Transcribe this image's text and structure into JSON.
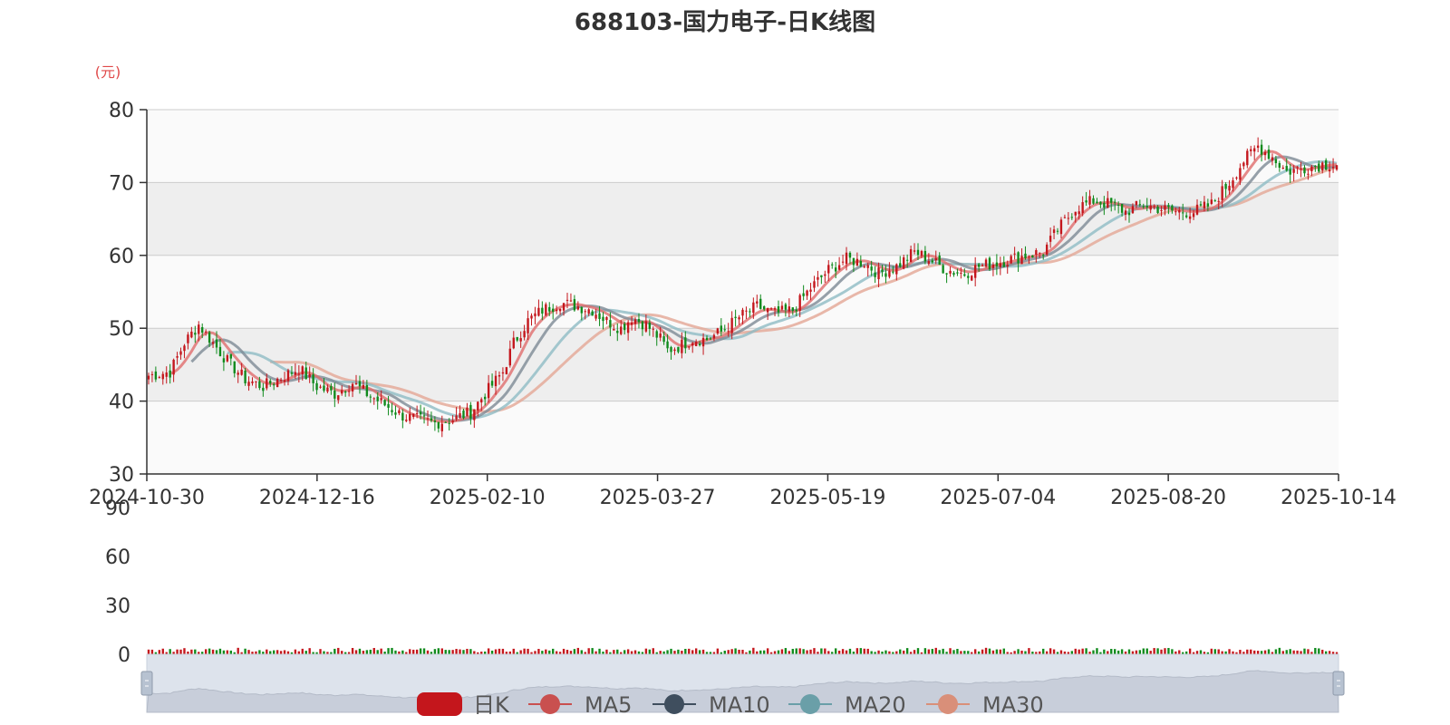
{
  "chart_data": {
    "type": "candlestick",
    "title": "688103-国力电子-日K线图",
    "y_unit": "(元)",
    "ylim": [
      30,
      80
    ],
    "y_ticks": [
      30,
      40,
      50,
      60,
      70,
      80
    ],
    "x_ticks": [
      "2024-10-30",
      "2024-12-16",
      "2025-02-10",
      "2025-03-27",
      "2025-05-19",
      "2025-07-04",
      "2025-08-20",
      "2025-10-14"
    ],
    "volume_ticks": [
      0,
      30,
      60,
      90
    ],
    "volume_ylim": [
      0,
      90
    ],
    "legend": [
      "日K",
      "MA5",
      "MA10",
      "MA20",
      "MA30"
    ],
    "series_colors": {
      "up": "#c4161c",
      "down": "#0f8a1c",
      "MA5": "#e06d6d",
      "MA10": "#7d8a95",
      "MA20": "#8fbcc4",
      "MA30": "#e3a695"
    },
    "price_path_points": [
      [
        0,
        43.5
      ],
      [
        6,
        44.0
      ],
      [
        10,
        48.0
      ],
      [
        14,
        50.5
      ],
      [
        18,
        48.0
      ],
      [
        22,
        45.5
      ],
      [
        27,
        43.0
      ],
      [
        32,
        42.0
      ],
      [
        38,
        43.5
      ],
      [
        42,
        44.5
      ],
      [
        47,
        42.0
      ],
      [
        52,
        41.0
      ],
      [
        57,
        42.5
      ],
      [
        61,
        41.0
      ],
      [
        66,
        39.5
      ],
      [
        71,
        38.0
      ],
      [
        75,
        37.5
      ],
      [
        80,
        37.0
      ],
      [
        85,
        37.5
      ],
      [
        90,
        38.5
      ],
      [
        94,
        41.0
      ],
      [
        99,
        44.0
      ],
      [
        102,
        48.0
      ],
      [
        106,
        51.0
      ],
      [
        110,
        52.5
      ],
      [
        115,
        53.5
      ],
      [
        120,
        53.0
      ],
      [
        124,
        52.5
      ],
      [
        128,
        51.0
      ],
      [
        132,
        50.0
      ],
      [
        135,
        51.5
      ],
      [
        139,
        50.5
      ],
      [
        143,
        48.5
      ],
      [
        145,
        47.0
      ],
      [
        148,
        47.5
      ],
      [
        152,
        48.5
      ],
      [
        156,
        48.5
      ],
      [
        160,
        49.5
      ],
      [
        165,
        51.5
      ],
      [
        170,
        53.0
      ],
      [
        175,
        52.0
      ],
      [
        180,
        52.5
      ],
      [
        185,
        55.5
      ],
      [
        190,
        58.0
      ],
      [
        195,
        59.5
      ],
      [
        200,
        59.0
      ],
      [
        204,
        57.5
      ],
      [
        209,
        58.5
      ],
      [
        214,
        60.5
      ],
      [
        218,
        59.5
      ],
      [
        223,
        58.0
      ],
      [
        228,
        57.5
      ],
      [
        232,
        58.5
      ],
      [
        237,
        59.0
      ],
      [
        241,
        59.5
      ],
      [
        245,
        60.0
      ],
      [
        250,
        60.5
      ],
      [
        254,
        63.5
      ],
      [
        259,
        66.5
      ],
      [
        264,
        67.5
      ],
      [
        269,
        67.0
      ],
      [
        273,
        66.0
      ],
      [
        278,
        67.0
      ],
      [
        282,
        66.5
      ],
      [
        287,
        66.0
      ],
      [
        292,
        66.0
      ],
      [
        297,
        67.0
      ],
      [
        302,
        70.0
      ],
      [
        306,
        73.0
      ],
      [
        310,
        75.0
      ],
      [
        314,
        73.5
      ],
      [
        318,
        71.5
      ],
      [
        323,
        72.0
      ],
      [
        328,
        72.5
      ],
      [
        332,
        72.5
      ]
    ],
    "ma_lag": {
      "MA5": 3,
      "MA10": 6,
      "MA20": 11,
      "MA30": 17
    }
  }
}
